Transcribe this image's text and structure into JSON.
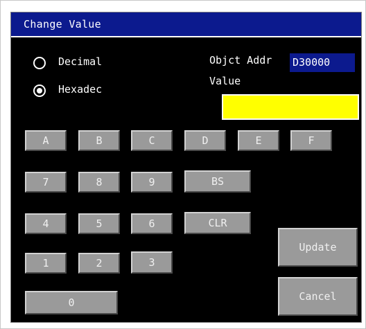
{
  "dialog": {
    "title": "Change Value"
  },
  "radix": {
    "decimal_label": "Decimal",
    "hexadec_label": "Hexadec",
    "selected": "Hexadec"
  },
  "object_addr": {
    "label": "Objct Addr",
    "value": "D30000"
  },
  "value": {
    "label": "Value",
    "current": ""
  },
  "keys": {
    "A": "A",
    "B": "B",
    "C": "C",
    "D": "D",
    "E": "E",
    "F": "F",
    "k7": "7",
    "k8": "8",
    "k9": "9",
    "bs": "BS",
    "k4": "4",
    "k5": "5",
    "k6": "6",
    "clr": "CLR",
    "k1": "1",
    "k2": "2",
    "k3": "3",
    "k0": "0"
  },
  "actions": {
    "update": "Update",
    "cancel": "Cancel"
  },
  "colors": {
    "title_bar": "#0c1a8e",
    "value_field": "#ffff00",
    "key_face": "#9a9a9a",
    "background": "#000000"
  }
}
